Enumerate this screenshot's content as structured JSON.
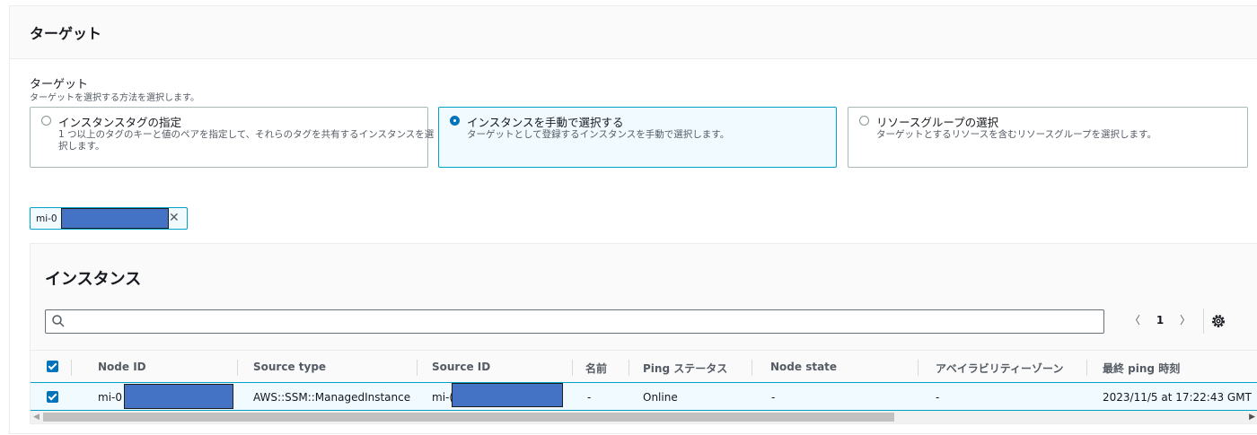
{
  "section": {
    "title": "ターゲット"
  },
  "target_field": {
    "label": "ターゲット",
    "description": "ターゲットを選択する方法を選択します。"
  },
  "options": [
    {
      "title": "インスタンスタグの指定",
      "description": "1 つ以上のタグのキーと値のペアを指定して、それらのタグを共有するインスタンスを選択します。",
      "selected": false
    },
    {
      "title": "インスタンスを手動で選択する",
      "description": "ターゲットとして登録するインスタンスを手動で選択します。",
      "selected": true
    },
    {
      "title": "リソースグループの選択",
      "description": "ターゲットとするリソースを含むリソースグループを選択します。",
      "selected": false
    }
  ],
  "token": {
    "label": "mi-0",
    "remove": "✕"
  },
  "instances": {
    "title": "インスタンス",
    "search_placeholder": "",
    "pagination": {
      "prev": "〈",
      "page": "1",
      "next": "〉"
    },
    "columns": [
      "Node ID",
      "Source type",
      "Source ID",
      "名前",
      "Ping ステータス",
      "Node state",
      "アベイラビリティーゾーン",
      "最終 ping 時刻"
    ],
    "rows": [
      {
        "node_id": "mi-0",
        "source_type": "AWS::SSM::ManagedInstance",
        "source_id": "mi-(",
        "name": "-",
        "ping_status": "Online",
        "node_state": "-",
        "availability_zone": "-",
        "last_ping": "2023/11/5 at 17:22:43 GMT",
        "checked": true
      }
    ]
  },
  "colors": {
    "accent": "#0073bb",
    "selected_border": "#00a1c9",
    "selected_bg": "#f1faff",
    "redaction": "#4472c4"
  }
}
